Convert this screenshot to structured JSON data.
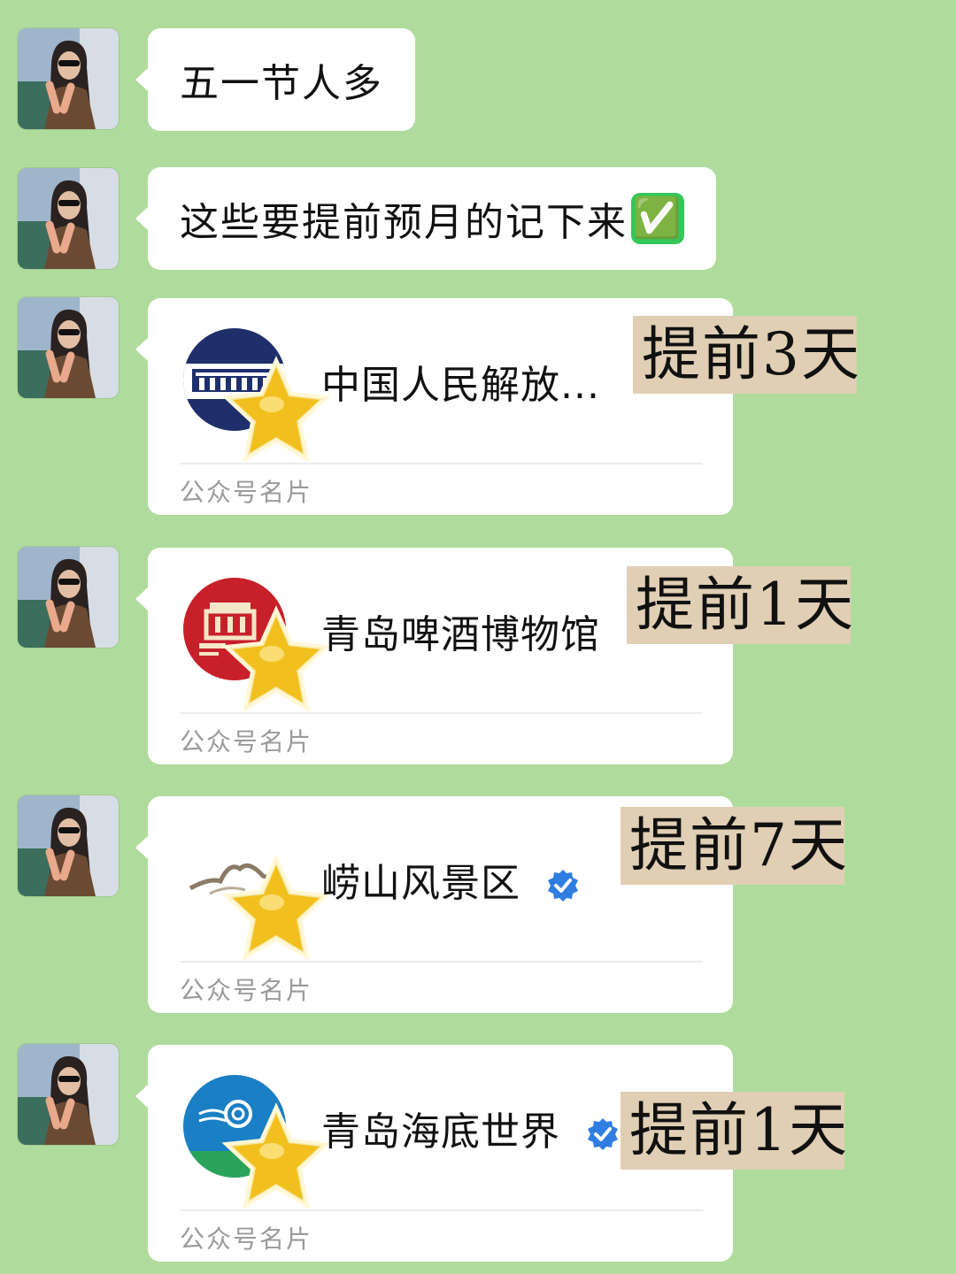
{
  "messages": [
    {
      "type": "text",
      "text": "五一节人多"
    },
    {
      "type": "text",
      "text": "这些要提前预月的记下来",
      "emoji": "✅"
    }
  ],
  "cards": [
    {
      "name": "中国人民解放...",
      "type_label": "公众号名片",
      "verified": false,
      "tag": "提前3天",
      "logo_icon": "museum-building-logo",
      "logo_color": "#1e2f6b"
    },
    {
      "name": "青岛啤酒博物馆",
      "type_label": "公众号名片",
      "verified": false,
      "tag": "提前1天",
      "logo_icon": "beer-museum-logo",
      "logo_color": "#c8202a"
    },
    {
      "name": "崂山风景区",
      "type_label": "公众号名片",
      "verified": true,
      "tag": "提前7天",
      "logo_icon": "mountain-logo",
      "logo_color": "#ffffff"
    },
    {
      "name": "青岛海底世界",
      "type_label": "公众号名片",
      "verified": true,
      "tag": "提前1天",
      "logo_icon": "ocean-swirl-logo",
      "logo_color": "#1a7fc4"
    }
  ],
  "colors": {
    "background": "#afdc9c",
    "bubble": "#ffffff",
    "tag_background": "#e0cfb4",
    "verified": "#2f7de1",
    "star": "#f2c01e"
  }
}
